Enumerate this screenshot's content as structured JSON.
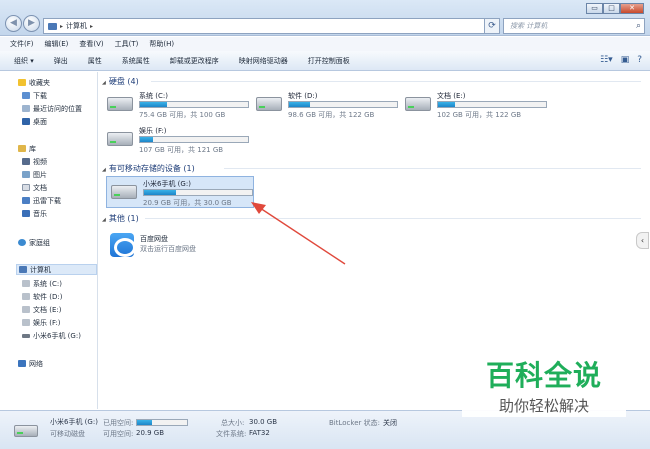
{
  "window": {
    "address": [
      "计算机"
    ],
    "search_placeholder": "搜索 计算机",
    "controls": {
      "minimize": "▭",
      "maximize": "□",
      "close": "✕"
    }
  },
  "menu": [
    "文件(F)",
    "编辑(E)",
    "查看(V)",
    "工具(T)",
    "帮助(H)"
  ],
  "toolbar": [
    "组织 ▾",
    "弹出",
    "属性",
    "系统属性",
    "卸载或更改程序",
    "映射网络驱动器",
    "打开控制面板"
  ],
  "sidebar": {
    "favorites": {
      "label": "收藏夹",
      "items": [
        "下载",
        "最近访问的位置",
        "桌面"
      ]
    },
    "libraries": {
      "label": "库",
      "items": [
        "视频",
        "图片",
        "文档",
        "迅雷下载",
        "音乐"
      ]
    },
    "homegroup": "家庭组",
    "computer": {
      "label": "计算机",
      "items": [
        "系统 (C:)",
        "软件 (D:)",
        "文档 (E:)",
        "娱乐 (F:)",
        "小米6手机 (G:)"
      ]
    },
    "network": "网络"
  },
  "groups": {
    "hard_disks": "硬盘 (4)",
    "removable": "有可移动存储的设备 (1)",
    "other": "其他 (1)"
  },
  "drives": [
    {
      "name": "系统 (C:)",
      "info": "75.4 GB 可用，共 100 GB",
      "used_fraction": 0.25
    },
    {
      "name": "软件 (D:)",
      "info": "98.6 GB 可用，共 122 GB",
      "used_fraction": 0.19
    },
    {
      "name": "文档 (E:)",
      "info": "102 GB 可用，共 122 GB",
      "used_fraction": 0.16
    },
    {
      "name": "娱乐 (F:)",
      "info": "107 GB 可用，共 121 GB",
      "used_fraction": 0.12
    }
  ],
  "removable_drive": {
    "name": "小米6手机 (G:)",
    "info": "20.9 GB 可用，共 30.0 GB",
    "used_fraction": 0.3
  },
  "other_item": {
    "name": "百度网盘",
    "subtitle": "双击运行百度网盘"
  },
  "status": {
    "name": "小米6手机 (G:)",
    "type": "可移动磁盘",
    "used_label": "已用空间:",
    "free_label": "可用空间:",
    "free_value": "20.9 GB",
    "total_label": "总大小:",
    "total_value": "30.0 GB",
    "fs_label": "文件系统:",
    "fs_value": "FAT32",
    "bitlocker_label": "BitLocker 状态:",
    "bitlocker_value": "关闭",
    "used_fraction": 0.3
  },
  "watermark": {
    "title": "百科全说",
    "subtitle": "助你轻松解决"
  },
  "colors": {
    "accent": "#1d86c9",
    "watermark_green": "#1fae5a",
    "arrow": "#e0493c"
  }
}
